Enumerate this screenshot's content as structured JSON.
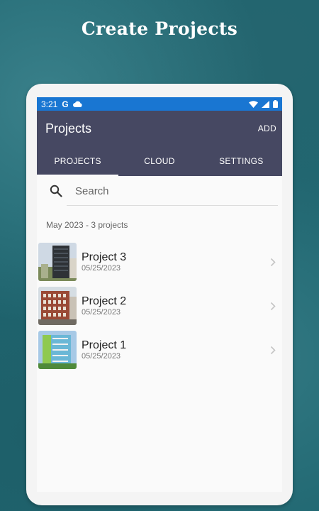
{
  "headline": "Create Projects",
  "status_bar": {
    "time": "3:21",
    "g_label": "G",
    "icons": [
      "google-icon",
      "cloud-icon",
      "wifi-icon",
      "signal-icon",
      "battery-icon"
    ]
  },
  "app_bar": {
    "title": "Projects",
    "action": "ADD",
    "color": "#464862"
  },
  "tabs": [
    {
      "label": "PROJECTS",
      "active": true
    },
    {
      "label": "CLOUD",
      "active": false
    },
    {
      "label": "SETTINGS",
      "active": false
    }
  ],
  "search": {
    "placeholder": "Search",
    "value": ""
  },
  "section_header": "May 2023 - 3 projects",
  "projects": [
    {
      "name": "Project 3",
      "date": "05/25/2023",
      "thumbnail": "tall-gray-building"
    },
    {
      "name": "Project 2",
      "date": "05/25/2023",
      "thumbnail": "red-brick-building"
    },
    {
      "name": "Project 1",
      "date": "05/25/2023",
      "thumbnail": "blue-green-building"
    }
  ],
  "colors": {
    "status_bar": "#1976d2",
    "app_bar": "#464862",
    "background": "#1f6670"
  }
}
